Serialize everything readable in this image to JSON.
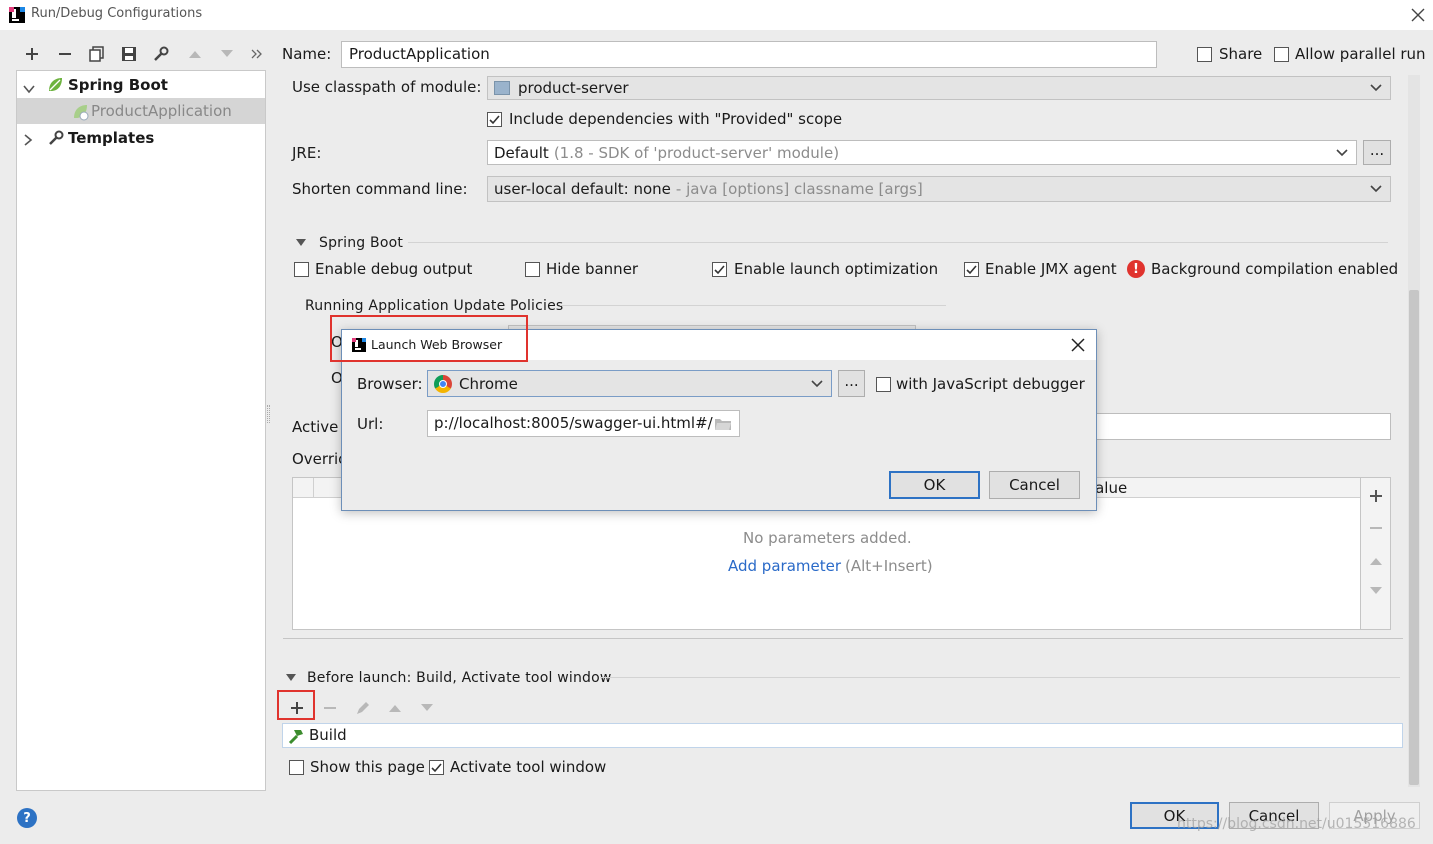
{
  "window": {
    "title": "Run/Debug Configurations"
  },
  "tree": {
    "items": [
      {
        "label": "Spring Boot"
      },
      {
        "label": "ProductApplication"
      },
      {
        "label": "Templates"
      }
    ]
  },
  "header": {
    "name_label": "Name:",
    "name_value": "ProductApplication",
    "share_label": "Share",
    "parallel_label": "Allow parallel run"
  },
  "config": {
    "classpath_label": "Use classpath of module:",
    "classpath_value": "product-server",
    "include_deps_label": "Include dependencies with \"Provided\" scope",
    "jre_label": "JRE:",
    "jre_value": "Default",
    "jre_hint": "(1.8 - SDK of 'product-server' module)",
    "jre_more": "...",
    "shorten_label": "Shorten command line:",
    "shorten_value": "user-local default: none",
    "shorten_hint": "- java [options] classname [args]"
  },
  "spring_boot": {
    "title": "Spring Boot",
    "debug_output": "Enable debug output",
    "hide_banner": "Hide banner",
    "launch_opt": "Enable launch optimization",
    "jmx_agent": "Enable JMX agent",
    "bg_compilation": "Background compilation enabled",
    "policies_title": "Running Application Update Policies",
    "policy_1_prefix": "O",
    "policy_2_prefix": "O",
    "active_label": "Active",
    "override_label": "Overric",
    "col_value": "Value",
    "no_params": "No parameters added.",
    "add_param": "Add parameter",
    "add_param_hint": "(Alt+Insert)"
  },
  "before_launch": {
    "title": "Before launch: Build, Activate tool window",
    "task": "Build",
    "show_page": "Show this page",
    "activate_tool": "Activate tool window"
  },
  "footer": {
    "help": "?",
    "ok": "OK",
    "cancel": "Cancel",
    "apply": "Apply",
    "watermark": "https://blog.csdn.net/u015516886"
  },
  "dialog": {
    "title": "Launch Web Browser",
    "browser_label": "Browser:",
    "browser_value": "Chrome",
    "browser_more": "...",
    "js_debugger": "with JavaScript debugger",
    "url_label": "Url:",
    "url_value": "p://localhost:8005/swagger-ui.html#/",
    "ok": "OK",
    "cancel": "Cancel"
  },
  "colors": {
    "accent": "#2d72c4",
    "selection": "#d5d5d5",
    "highlight_border": "#e0332e",
    "link": "#2a6ac8",
    "error": "#e0332e"
  }
}
